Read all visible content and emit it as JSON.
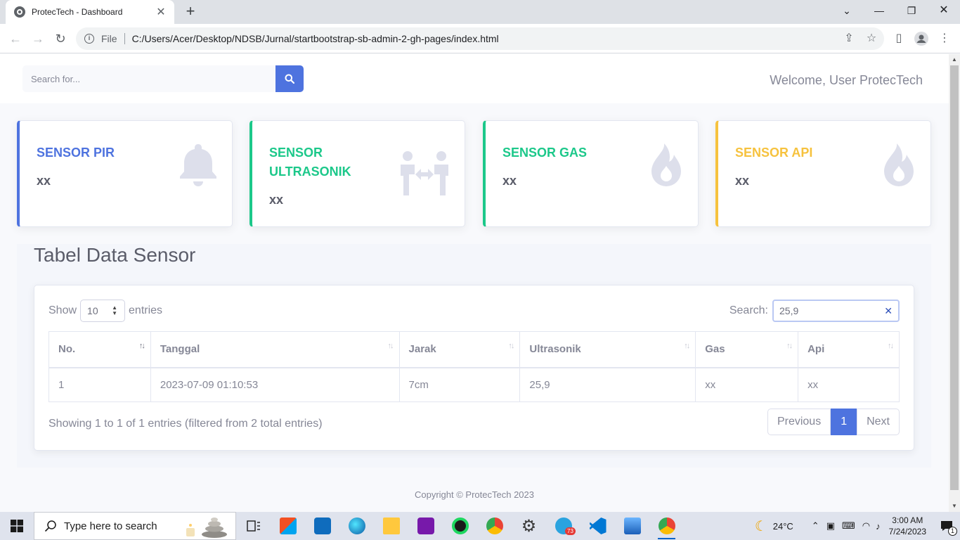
{
  "browser": {
    "tab_title": "ProtecTech - Dashboard",
    "file_label": "File",
    "url": "C:/Users/Acer/Desktop/NDSB/Jurnal/startbootstrap-sb-admin-2-gh-pages/index.html"
  },
  "topbar": {
    "search_placeholder": "Search for...",
    "welcome": "Welcome, User ProtecTech"
  },
  "cards": [
    {
      "label": "SENSOR PIR",
      "value": "xx",
      "color": "#4e73df",
      "icon": "bell-icon"
    },
    {
      "label": "SENSOR ULTRASONIK",
      "value": "xx",
      "color": "#1cc88a",
      "icon": "people-arrows-icon"
    },
    {
      "label": "SENSOR GAS",
      "value": "xx",
      "color": "#1cc88a",
      "icon": "fire-icon"
    },
    {
      "label": "SENSOR API",
      "value": "xx",
      "color": "#f6c23e",
      "icon": "fire-icon"
    }
  ],
  "table_section": {
    "title": "Tabel Data Sensor",
    "show_label": "Show",
    "page_length": "10",
    "entries_label": "entries",
    "search_label": "Search:",
    "search_value": "25,9",
    "columns": [
      "No.",
      "Tanggal",
      "Jarak",
      "Ultrasonik",
      "Gas",
      "Api"
    ],
    "rows": [
      [
        "1",
        "2023-07-09 01:10:53",
        "7cm",
        "25,9",
        "xx",
        "xx"
      ]
    ],
    "info": "Showing 1 to 1 of 1 entries (filtered from 2 total entries)",
    "pager": {
      "previous": "Previous",
      "current": "1",
      "next": "Next"
    }
  },
  "footer": "Copyright © ProtecTech 2023",
  "taskbar": {
    "search_placeholder": "Type here to search",
    "weather": "24°C",
    "time": "3:00 AM",
    "date": "7/24/2023",
    "telegram_badge": "73",
    "notification_count": "1"
  },
  "colors": {
    "primary": "#4e73df",
    "success": "#1cc88a",
    "warning": "#f6c23e",
    "text_gray": "#858796"
  }
}
